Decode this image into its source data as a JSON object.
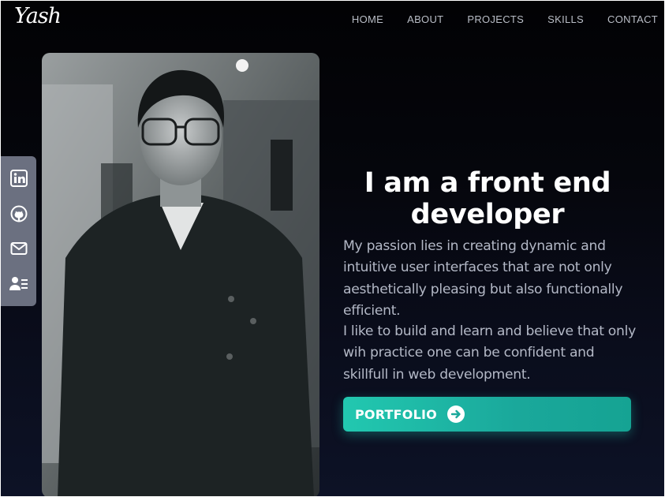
{
  "brand": {
    "logo_text": "Yash"
  },
  "nav": {
    "items": [
      "HOME",
      "ABOUT",
      "PROJECTS",
      "SKILLS",
      "CONTACT"
    ]
  },
  "social": {
    "icons": [
      "linkedin-icon",
      "github-icon",
      "mail-icon",
      "resume-icon"
    ]
  },
  "hero": {
    "headline": "I am a front end developer",
    "paragraph_1": "My passion lies in creating dynamic and intuitive user interfaces that are not only aesthetically pleasing but also functionally efficient.",
    "paragraph_2": "I like to build and learn and believe that only wih practice one can be confident and skillfull in web development.",
    "button_label": "PORTFOLIO",
    "button_icon": "arrow-right-circle-icon"
  },
  "colors": {
    "accent": "#1fbfa9",
    "background": "#05060c",
    "sidebar": "#6b7080"
  }
}
